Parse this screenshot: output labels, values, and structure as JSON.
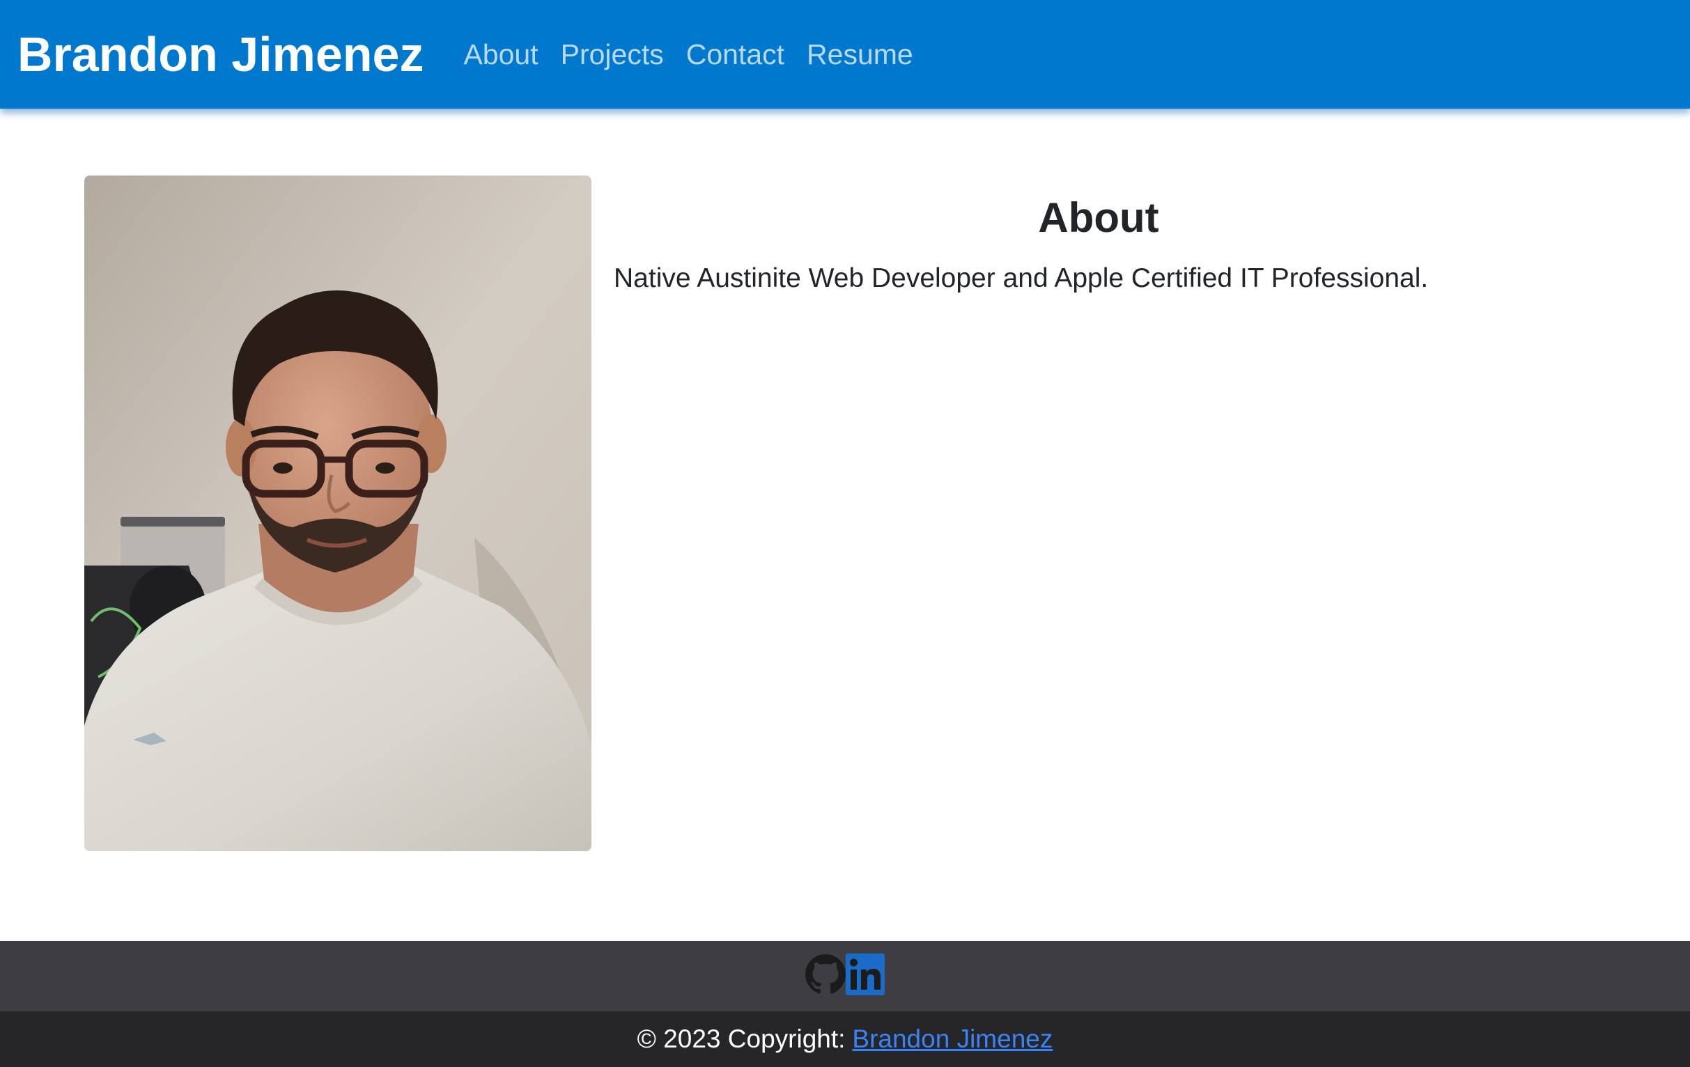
{
  "navbar": {
    "brand": "Brandon Jimenez",
    "links": [
      {
        "label": "About"
      },
      {
        "label": "Projects"
      },
      {
        "label": "Contact"
      },
      {
        "label": "Resume"
      }
    ],
    "background_color": "#0078cd"
  },
  "about": {
    "photo_icon": "profile-photo",
    "title": "About",
    "text": "Native Austinite Web Developer and Apple Certified IT Professional."
  },
  "footer": {
    "social_icons": [
      "github-icon",
      "linkedin-icon"
    ],
    "copyright_prefix": "© 2023 Copyright:",
    "copyright_link": "Brandon Jimenez",
    "link_color": "#3b82f6"
  }
}
